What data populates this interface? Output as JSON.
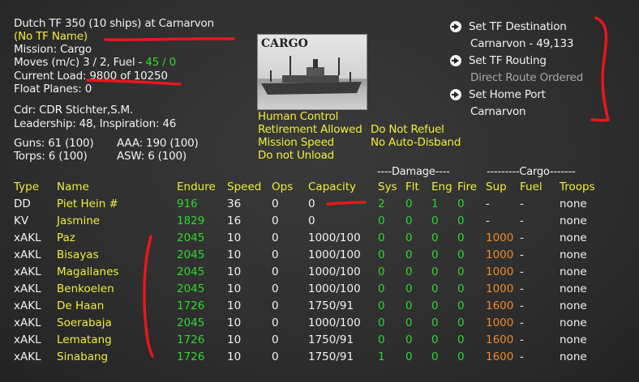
{
  "header": {
    "title": "Dutch TF 350 (10 ships) at Carnarvon",
    "tf_name": "(No TF Name)",
    "mission": "Mission: Cargo",
    "moves_prefix": "Moves (m/c) 3 / 2, Fuel - ",
    "fuel_value": "45 / 0",
    "current_load": "Current Load: 9800 of 10250",
    "float_planes": "Float Planes: 0",
    "commander": "Cdr: CDR Stichter,S.M.",
    "leadership": "Leadership: 48, Inspiration: 46",
    "guns": "Guns: 61 (100)",
    "aaa": "AAA: 190 (100)",
    "torps": "Torps: 6 (100)",
    "asw": "ASW: 6 (100)"
  },
  "photo": {
    "caption": "CARGO"
  },
  "settings": {
    "human_control": "Human Control",
    "retirement": "Retirement Allowed",
    "mission_speed": "Mission Speed",
    "unload": "Do not Unload",
    "refuel": "Do Not Refuel",
    "disband": "No Auto-Disband"
  },
  "actions": {
    "destination_label": "Set TF Destination",
    "destination_value": "Carnarvon - 49,133",
    "routing_label": "Set TF Routing",
    "routing_value": "Direct Route Ordered",
    "home_label": "Set Home Port",
    "home_value": "Carnarvon"
  },
  "table": {
    "damage_group": "----Damage----",
    "cargo_group": "---------Cargo-------",
    "columns": [
      "Type",
      "Name",
      "Endure",
      "Speed",
      "Ops",
      "Capacity",
      "Sys",
      "Flt",
      "Eng",
      "Fire",
      "Sup",
      "Fuel",
      "Troops"
    ],
    "rows": [
      {
        "type": "DD",
        "name": "Piet Hein #",
        "endure": "916",
        "speed": "36",
        "ops": "0",
        "capacity": "0",
        "sys": "2",
        "flt": "0",
        "eng": "1",
        "fire": "0",
        "sup": "-",
        "fuel": "-",
        "troops": "none"
      },
      {
        "type": "KV",
        "name": "Jasmine",
        "endure": "1829",
        "speed": "16",
        "ops": "0",
        "capacity": "0",
        "sys": "0",
        "flt": "0",
        "eng": "0",
        "fire": "0",
        "sup": "-",
        "fuel": "-",
        "troops": "none"
      },
      {
        "type": "xAKL",
        "name": "Paz",
        "endure": "2045",
        "speed": "10",
        "ops": "0",
        "capacity": "1000/100",
        "sys": "0",
        "flt": "0",
        "eng": "0",
        "fire": "0",
        "sup": "1000",
        "fuel": "-",
        "troops": "none"
      },
      {
        "type": "xAKL",
        "name": "Bisayas",
        "endure": "2045",
        "speed": "10",
        "ops": "0",
        "capacity": "1000/100",
        "sys": "0",
        "flt": "0",
        "eng": "0",
        "fire": "0",
        "sup": "1000",
        "fuel": "-",
        "troops": "none"
      },
      {
        "type": "xAKL",
        "name": "Magallanes",
        "endure": "2045",
        "speed": "10",
        "ops": "0",
        "capacity": "1000/100",
        "sys": "0",
        "flt": "0",
        "eng": "0",
        "fire": "0",
        "sup": "1000",
        "fuel": "-",
        "troops": "none"
      },
      {
        "type": "xAKL",
        "name": "Benkoelen",
        "endure": "2045",
        "speed": "10",
        "ops": "0",
        "capacity": "1000/100",
        "sys": "0",
        "flt": "0",
        "eng": "0",
        "fire": "0",
        "sup": "1000",
        "fuel": "-",
        "troops": "none"
      },
      {
        "type": "xAKL",
        "name": "De Haan",
        "endure": "1726",
        "speed": "10",
        "ops": "0",
        "capacity": "1750/91",
        "sys": "0",
        "flt": "0",
        "eng": "0",
        "fire": "0",
        "sup": "1600",
        "fuel": "-",
        "troops": "none"
      },
      {
        "type": "xAKL",
        "name": "Soerabaja",
        "endure": "2045",
        "speed": "10",
        "ops": "0",
        "capacity": "1000/100",
        "sys": "0",
        "flt": "0",
        "eng": "0",
        "fire": "0",
        "sup": "1000",
        "fuel": "-",
        "troops": "none"
      },
      {
        "type": "xAKL",
        "name": "Lematang",
        "endure": "1726",
        "speed": "10",
        "ops": "0",
        "capacity": "1750/91",
        "sys": "0",
        "flt": "0",
        "eng": "0",
        "fire": "0",
        "sup": "1600",
        "fuel": "-",
        "troops": "none"
      },
      {
        "type": "xAKL",
        "name": "Sinabang",
        "endure": "1726",
        "speed": "10",
        "ops": "0",
        "capacity": "1750/91",
        "sys": "1",
        "flt": "0",
        "eng": "0",
        "fire": "0",
        "sup": "1600",
        "fuel": "-",
        "troops": "none"
      }
    ]
  },
  "colors": {
    "text_white": "#f2f2f2",
    "text_yellow": "#f0ee3a",
    "text_green": "#2fd82f",
    "text_orange": "#f08a2a",
    "text_grey": "#a8a8a8",
    "annotation_red": "#e8171b"
  },
  "icons": {
    "action_bullet": "arrow-right-circle-icon"
  }
}
